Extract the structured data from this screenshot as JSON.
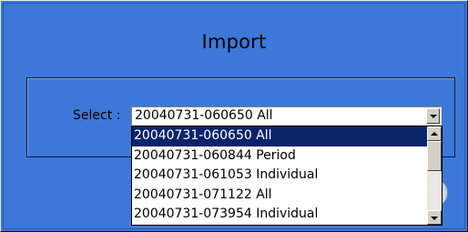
{
  "dialog": {
    "title": "Import",
    "select_label": "Select :",
    "combo": {
      "value": "20040731-060650 All",
      "options": [
        "20040731-060650 All",
        "20040731-060844 Period",
        "20040731-061053 Individual",
        "20040731-071122 All",
        "20040731-073954 Individual"
      ],
      "selected_index": 0
    }
  },
  "colors": {
    "background": "#3b78d8",
    "selection": "#0a246a"
  },
  "icons": [
    "chevron-down-icon",
    "scroll-up-icon",
    "scroll-down-icon"
  ]
}
